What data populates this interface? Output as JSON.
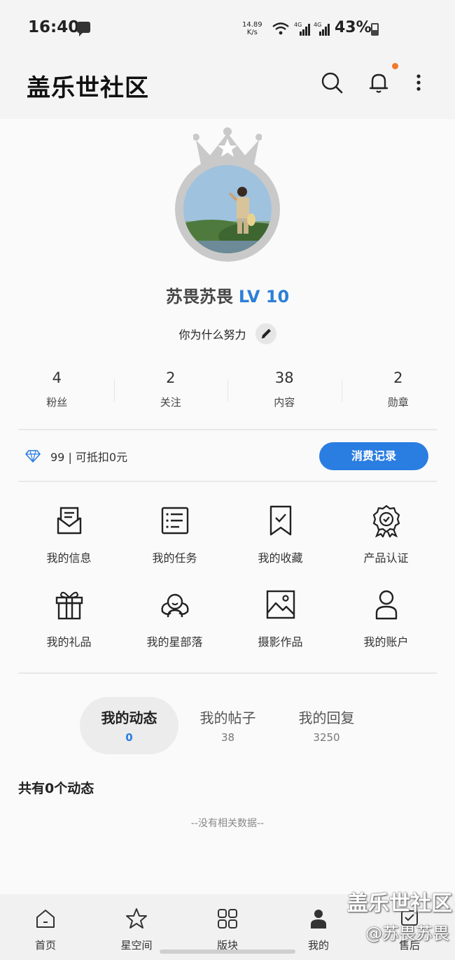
{
  "status_bar": {
    "time": "16:40",
    "net_speed_value": "14.89",
    "net_speed_unit": "K/s",
    "signal_1": "4G",
    "signal_2": "4G",
    "battery": "43%"
  },
  "header": {
    "title": "盖乐世社区",
    "search_icon": "search-icon",
    "bell_icon": "bell-icon",
    "more_icon": "more-vertical-icon",
    "notification_dot_color": "#f07a2a"
  },
  "profile": {
    "username": "苏畏苏畏",
    "level": "LV 10",
    "bio": "你为什么努力",
    "level_color": "#2d7fd8"
  },
  "stats": [
    {
      "value": "4",
      "label": "粉丝"
    },
    {
      "value": "2",
      "label": "关注"
    },
    {
      "value": "38",
      "label": "内容"
    },
    {
      "value": "2",
      "label": "勋章"
    }
  ],
  "points": {
    "text": "99 | 可抵扣0元",
    "button": "消费记录",
    "accent": "#2a7de1"
  },
  "grid": [
    {
      "label": "我的信息",
      "icon": "mail-icon"
    },
    {
      "label": "我的任务",
      "icon": "task-list-icon"
    },
    {
      "label": "我的收藏",
      "icon": "bookmark-icon"
    },
    {
      "label": "产品认证",
      "icon": "certificate-badge-icon"
    },
    {
      "label": "我的礼品",
      "icon": "gift-icon"
    },
    {
      "label": "我的星部落",
      "icon": "group-icon"
    },
    {
      "label": "摄影作品",
      "icon": "image-icon"
    },
    {
      "label": "我的账户",
      "icon": "user-icon"
    }
  ],
  "tabs": [
    {
      "label": "我的动态",
      "count": "0",
      "active": true
    },
    {
      "label": "我的帖子",
      "count": "38",
      "active": false
    },
    {
      "label": "我的回复",
      "count": "3250",
      "active": false
    }
  ],
  "feed": {
    "count_title": "共有0个动态",
    "empty_text": "--没有相关数据--"
  },
  "bottom_nav": [
    {
      "label": "首页",
      "icon": "home-icon"
    },
    {
      "label": "星空间",
      "icon": "star-icon"
    },
    {
      "label": "版块",
      "icon": "grid-icon"
    },
    {
      "label": "我的",
      "icon": "person-icon",
      "active": true
    },
    {
      "label": "售后",
      "icon": "service-icon"
    }
  ],
  "watermark": {
    "line1": "盖乐世社区",
    "line2": "@苏畏苏畏"
  }
}
